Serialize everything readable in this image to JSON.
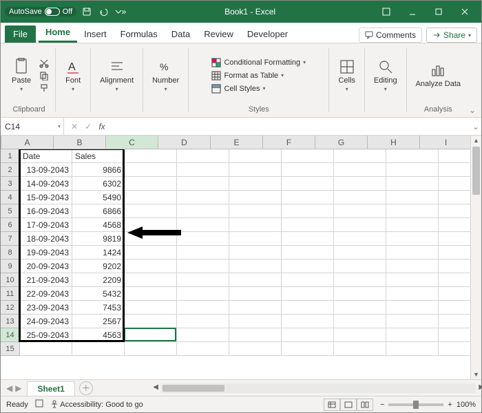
{
  "titlebar": {
    "autosave_label": "AutoSave",
    "autosave_state": "Off",
    "title": "Book1 - Excel"
  },
  "tabs": {
    "file": "File",
    "items": [
      "Home",
      "Insert",
      "Formulas",
      "Data",
      "Review",
      "Developer"
    ],
    "active": "Home",
    "comments": "Comments",
    "share": "Share"
  },
  "ribbon": {
    "clipboard": {
      "paste": "Paste",
      "label": "Clipboard"
    },
    "font": {
      "btn": "Font"
    },
    "alignment": {
      "btn": "Alignment"
    },
    "number": {
      "btn": "Number"
    },
    "styles": {
      "cond": "Conditional Formatting",
      "table": "Format as Table",
      "cell": "Cell Styles",
      "label": "Styles"
    },
    "cells": {
      "btn": "Cells"
    },
    "editing": {
      "btn": "Editing"
    },
    "analysis": {
      "btn": "Analyze Data",
      "label": "Analysis"
    }
  },
  "fbar": {
    "namebox": "C14",
    "formula": ""
  },
  "grid": {
    "columns": [
      "A",
      "B",
      "C",
      "D",
      "E",
      "F",
      "G",
      "H",
      "I"
    ],
    "active_col": "C",
    "rows": [
      1,
      2,
      3,
      4,
      5,
      6,
      7,
      8,
      9,
      10,
      11,
      12,
      13,
      14,
      15
    ],
    "active_row": 14,
    "headers": {
      "A": "Date",
      "B": "Sales"
    },
    "data": [
      {
        "date": "13-09-2043",
        "sales": "9866"
      },
      {
        "date": "14-09-2043",
        "sales": "6302"
      },
      {
        "date": "15-09-2043",
        "sales": "5490"
      },
      {
        "date": "16-09-2043",
        "sales": "6866"
      },
      {
        "date": "17-09-2043",
        "sales": "4568"
      },
      {
        "date": "18-09-2043",
        "sales": "9819"
      },
      {
        "date": "19-09-2043",
        "sales": "1424"
      },
      {
        "date": "20-09-2043",
        "sales": "9202"
      },
      {
        "date": "21-09-2043",
        "sales": "2209"
      },
      {
        "date": "22-09-2043",
        "sales": "5432"
      },
      {
        "date": "23-09-2043",
        "sales": "7453"
      },
      {
        "date": "24-09-2043",
        "sales": "2567"
      },
      {
        "date": "25-09-2043",
        "sales": "4563"
      }
    ],
    "selection": {
      "col": "C",
      "row": 14
    },
    "thick_range": "A1:B14"
  },
  "sheettabs": {
    "active": "Sheet1"
  },
  "status": {
    "ready": "Ready",
    "accessibility": "Accessibility: Good to go",
    "zoom": "100%"
  }
}
